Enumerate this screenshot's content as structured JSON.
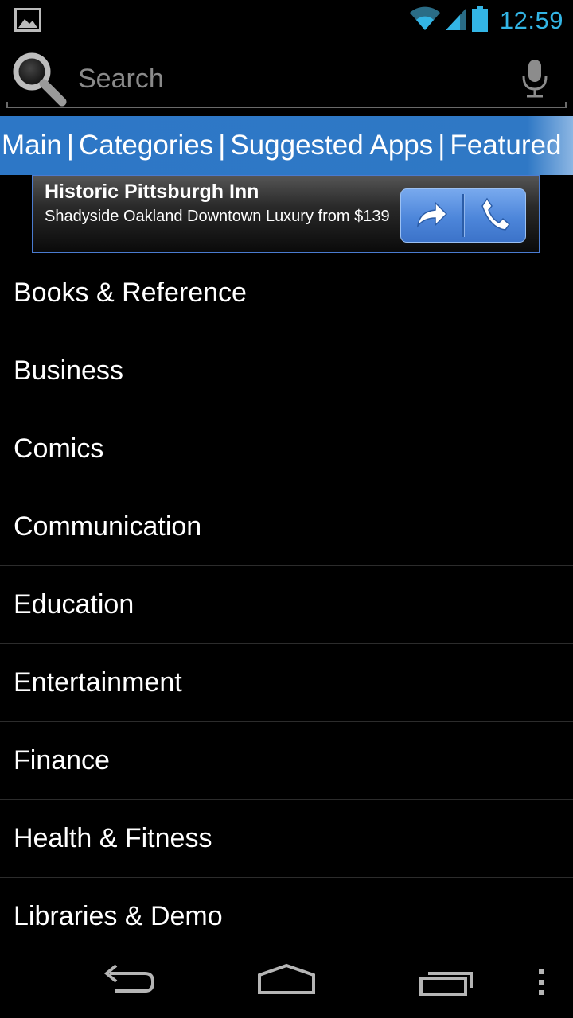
{
  "status_bar": {
    "notification_icon": "image-icon",
    "wifi_icon": "wifi-icon",
    "signal_icon": "cell-signal-icon",
    "battery_icon": "battery-icon",
    "time": "12:59",
    "time_color": "#33b5e5"
  },
  "search": {
    "placeholder": "Search",
    "search_icon": "magnifier-icon",
    "voice_icon": "microphone-icon"
  },
  "tabs": {
    "items": [
      {
        "label": "Main"
      },
      {
        "label": "Categories"
      },
      {
        "label": "Suggested Apps"
      },
      {
        "label": "Featured"
      }
    ],
    "separator": "|",
    "bar_color": "#2f78c5"
  },
  "ad": {
    "title": "Historic Pittsburgh Inn",
    "text": "Shadyside Oakland Downtown Luxury from $139",
    "directions_icon": "arrow-forward-icon",
    "call_icon": "phone-icon"
  },
  "categories": [
    {
      "label": "Books & Reference"
    },
    {
      "label": "Business"
    },
    {
      "label": "Comics"
    },
    {
      "label": "Communication"
    },
    {
      "label": "Education"
    },
    {
      "label": "Entertainment"
    },
    {
      "label": "Finance"
    },
    {
      "label": "Health & Fitness"
    },
    {
      "label": "Libraries & Demo"
    }
  ],
  "nav_bar": {
    "back_icon": "back-icon",
    "home_icon": "home-icon",
    "recents_icon": "recent-apps-icon",
    "menu_icon": "overflow-menu-icon"
  }
}
